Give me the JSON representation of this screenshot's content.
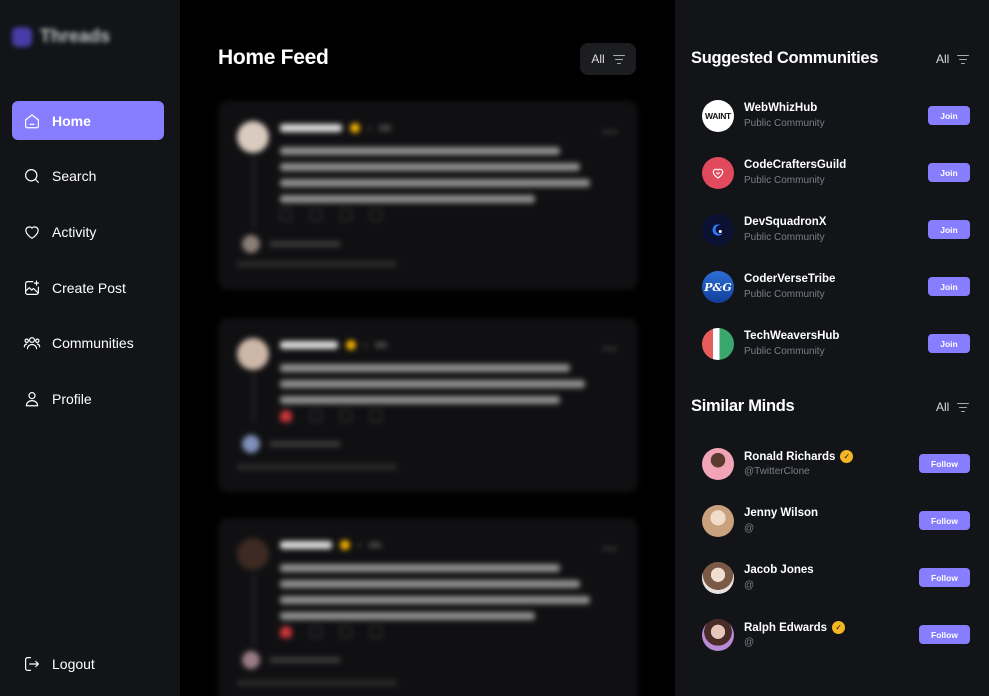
{
  "app": {
    "title": "Threads"
  },
  "sidebar": {
    "items": [
      {
        "label": "Home",
        "icon": "home-icon",
        "active": true
      },
      {
        "label": "Search",
        "icon": "search-icon",
        "active": false
      },
      {
        "label": "Activity",
        "icon": "heart-icon",
        "active": false
      },
      {
        "label": "Create Post",
        "icon": "create-post-icon",
        "active": false
      },
      {
        "label": "Communities",
        "icon": "communities-icon",
        "active": false
      },
      {
        "label": "Profile",
        "icon": "profile-icon",
        "active": false
      }
    ],
    "logout_label": "Logout"
  },
  "main": {
    "title": "Home Feed",
    "filter_label": "All"
  },
  "communities": {
    "title": "Suggested Communities",
    "filter_label": "All",
    "items": [
      {
        "name": "WebWhizHub",
        "type": "Public Community",
        "logo_text": "WAINT",
        "button": "Join"
      },
      {
        "name": "CodeCraftersGuild",
        "type": "Public Community",
        "button": "Join"
      },
      {
        "name": "DevSquadronX",
        "type": "Public Community",
        "button": "Join"
      },
      {
        "name": "CoderVerseTribe",
        "type": "Public Community",
        "logo_text": "P&G",
        "button": "Join"
      },
      {
        "name": "TechWeaversHub",
        "type": "Public Community",
        "button": "Join"
      }
    ]
  },
  "minds": {
    "title": "Similar Minds",
    "filter_label": "All",
    "items": [
      {
        "name": "Ronald Richards",
        "handle": "@TwitterClone",
        "verified": true,
        "button": "Follow"
      },
      {
        "name": "Jenny Wilson",
        "handle": "@",
        "verified": false,
        "button": "Follow"
      },
      {
        "name": "Jacob Jones",
        "handle": "@",
        "verified": false,
        "button": "Follow"
      },
      {
        "name": "Ralph Edwards",
        "handle": "@",
        "verified": true,
        "button": "Follow"
      }
    ]
  },
  "colors": {
    "accent": "#877eff",
    "sidebar_bg": "#121417",
    "main_bg": "#000000",
    "verified": "#f5b623"
  }
}
